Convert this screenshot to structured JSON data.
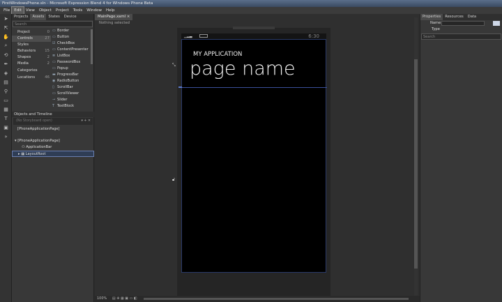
{
  "window_title": "FirstWindowsPhone.sln - Microsoft Expression Blend 4 for Windows Phone Beta",
  "menu": [
    "File",
    "Edit",
    "View",
    "Object",
    "Project",
    "Tools",
    "Window",
    "Help"
  ],
  "active_menu": "Edit",
  "left_tabs": [
    "Projects",
    "Assets",
    "States",
    "Device"
  ],
  "active_left_tab": "Assets",
  "search_placeholder": "Search",
  "categories": [
    {
      "label": "Project",
      "count": "0"
    },
    {
      "label": "Controls",
      "count": "27"
    },
    {
      "label": "Styles",
      "count": ""
    },
    {
      "label": "Behaviors",
      "count": "15"
    },
    {
      "label": "Shapes",
      "count": "2"
    },
    {
      "label": "Media",
      "count": "2"
    },
    {
      "label": "Categories",
      "count": ""
    },
    {
      "label": "Locations",
      "count": "46"
    }
  ],
  "controls": [
    "Border",
    "Button",
    "CheckBox",
    "ContentPresenter",
    "ListBox",
    "PasswordBox",
    "Popup",
    "ProgressBar",
    "RadioButton",
    "ScrollBar",
    "ScrollViewer",
    "Slider",
    "TextBlock"
  ],
  "objects_header": "Objects and Timeline",
  "storyboard_text": "(No Storyboard open)",
  "scope": "[PhoneApplicationPage]",
  "tree": [
    "[PhoneApplicationPage]",
    "ApplicationBar",
    "LayoutRoot"
  ],
  "doc_tab": "MainPage.xaml",
  "doc_close": "×",
  "selection_status": "Nothing selected",
  "phone": {
    "time": "6:30",
    "app_title": "MY APPLICATION",
    "page_title": "page name"
  },
  "right_tabs": [
    "Properties",
    "Resources",
    "Data"
  ],
  "active_right_tab": "Properties",
  "prop_name_label": "Name",
  "prop_type_label": "Type",
  "prop_search_placeholder": "Search",
  "zoom": "100%"
}
